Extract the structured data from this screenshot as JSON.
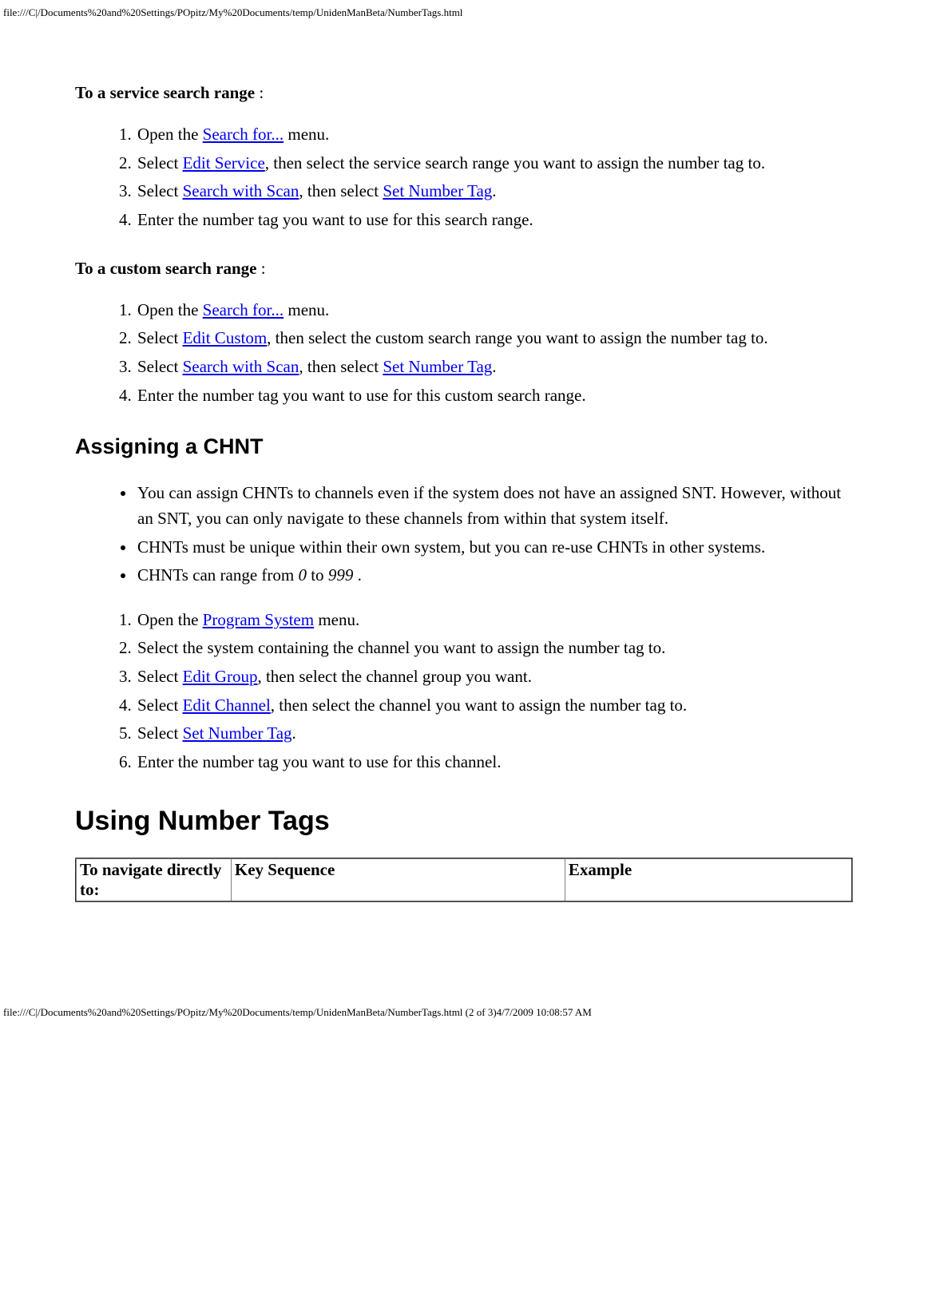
{
  "header_path": "file:///C|/Documents%20and%20Settings/POpitz/My%20Documents/temp/UnidenManBeta/NumberTags.html",
  "footer_path": "file:///C|/Documents%20and%20Settings/POpitz/My%20Documents/temp/UnidenManBeta/NumberTags.html (2 of 3)4/7/2009 10:08:57 AM",
  "service": {
    "heading_bold": "To a service search range",
    "heading_colon": " :",
    "steps": {
      "s1_pre": "Open the ",
      "s1_link": "Search for...",
      "s1_post": " menu.",
      "s2_pre": "Select ",
      "s2_link": "Edit Service",
      "s2_post": ", then select the service search range you want to assign the number tag to.",
      "s3_pre": "Select ",
      "s3_link1": "Search with Scan",
      "s3_mid": ", then select ",
      "s3_link2": "Set Number Tag",
      "s3_post": ".",
      "s4": "Enter the number tag you want to use for this search range."
    }
  },
  "custom": {
    "heading_bold": "To a custom search range",
    "heading_colon": " :",
    "steps": {
      "s1_pre": "Open the ",
      "s1_link": "Search for...",
      "s1_post": " menu.",
      "s2_pre": "Select ",
      "s2_link": "Edit Custom",
      "s2_post": ", then select the custom search range you want to assign the number tag to.",
      "s3_pre": "Select ",
      "s3_link1": "Search with Scan",
      "s3_mid": ", then select ",
      "s3_link2": "Set Number Tag",
      "s3_post": ".",
      "s4": "Enter the number tag you want to use for this custom search range."
    }
  },
  "chnt": {
    "heading": "Assigning a CHNT",
    "bullets": {
      "b1": "You can assign CHNTs to channels even if the system does not have an assigned SNT. However, without an SNT, you can only navigate to these channels from within that system itself.",
      "b2": "CHNTs must be unique within their own system, but you can re-use CHNTs in other systems.",
      "b3_pre": "CHNTs can range from ",
      "b3_i1": "0",
      "b3_mid": " to ",
      "b3_i2": "999",
      "b3_post": " ."
    },
    "steps": {
      "s1_pre": "Open the ",
      "s1_link": "Program System",
      "s1_post": " menu.",
      "s2": "Select the system containing the channel you want to assign the number tag to.",
      "s3_pre": "Select ",
      "s3_link": "Edit Group",
      "s3_post": ", then select the channel group you want.",
      "s4_pre": "Select ",
      "s4_link": "Edit Channel",
      "s4_post": ", then select the channel you want to assign the number tag to.",
      "s5_pre": "Select ",
      "s5_link": "Set Number Tag",
      "s5_post": ".",
      "s6": "Enter the number tag you want to use for this channel."
    }
  },
  "using": {
    "heading": "Using Number Tags",
    "table": {
      "h1": "To navigate directly to:",
      "h2": "Key Sequence",
      "h3": "Example"
    }
  }
}
